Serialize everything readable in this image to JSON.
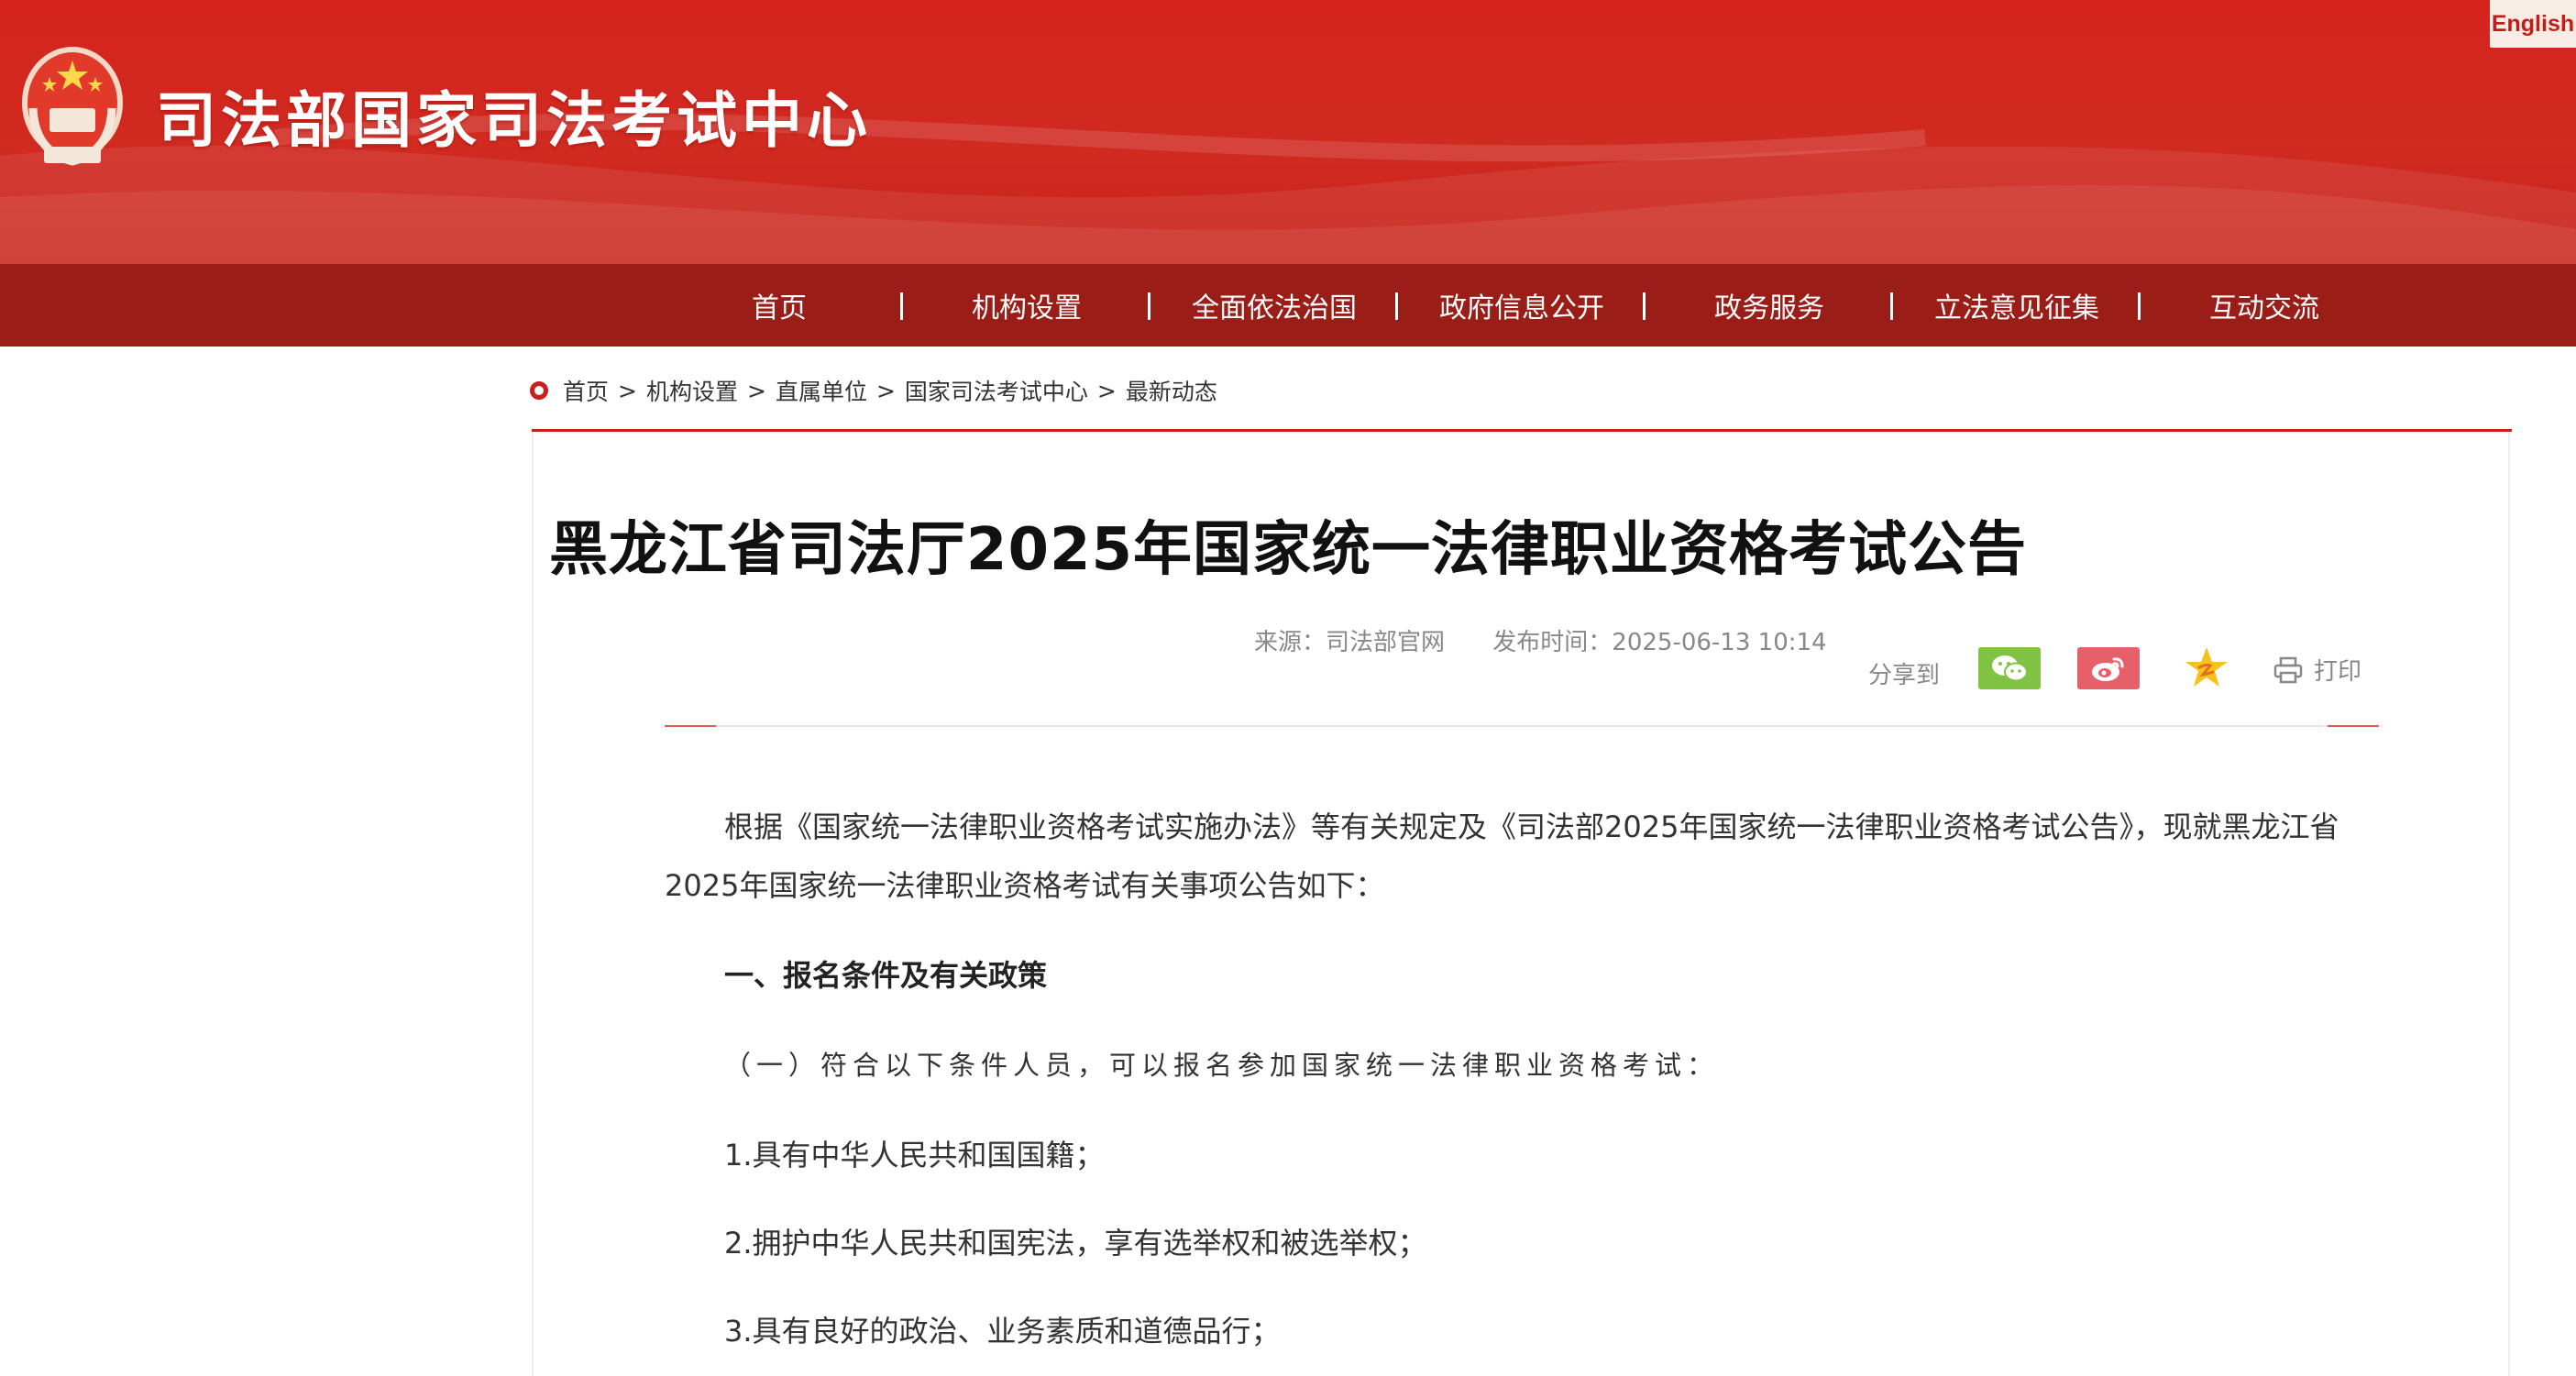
{
  "header": {
    "site_title": "司法部国家司法考试中心",
    "english_label": "English",
    "brand_color": "#d5231c",
    "nav_color": "#9b1d17"
  },
  "nav": {
    "items": [
      {
        "label": "首页"
      },
      {
        "label": "机构设置"
      },
      {
        "label": "全面依法治国"
      },
      {
        "label": "政府信息公开"
      },
      {
        "label": "政务服务"
      },
      {
        "label": "立法意见征集"
      },
      {
        "label": "互动交流"
      }
    ]
  },
  "breadcrumb": {
    "items": [
      "首页",
      "机构设置",
      "直属单位",
      "国家司法考试中心",
      "最新动态"
    ],
    "separator": ">"
  },
  "article": {
    "title": "黑龙江省司法厅2025年国家统一法律职业资格考试公告",
    "source": "来源：司法部官网",
    "published": "发布时间：2025-06-13 10:14",
    "share_label": "分享到",
    "print_label": "打印",
    "share_icons": [
      "wechat-icon",
      "weibo-icon",
      "favorite-icon",
      "printer-icon"
    ],
    "paragraphs": {
      "intro": "根据《国家统一法律职业资格考试实施办法》等有关规定及《司法部2025年国家统一法律职业资格考试公告》，现就黑龙江省2025年国家统一法律职业资格考试有关事项公告如下：",
      "section1": "一、报名条件及有关政策",
      "sub1": "（一）符合以下条件人员，可以报名参加国家统一法律职业资格考试：",
      "item1": "1.具有中华人民共和国国籍；",
      "item2": "2.拥护中华人民共和国宪法，享有选举权和被选举权；",
      "item3": "3.具有良好的政治、业务素质和道德品行；"
    }
  }
}
